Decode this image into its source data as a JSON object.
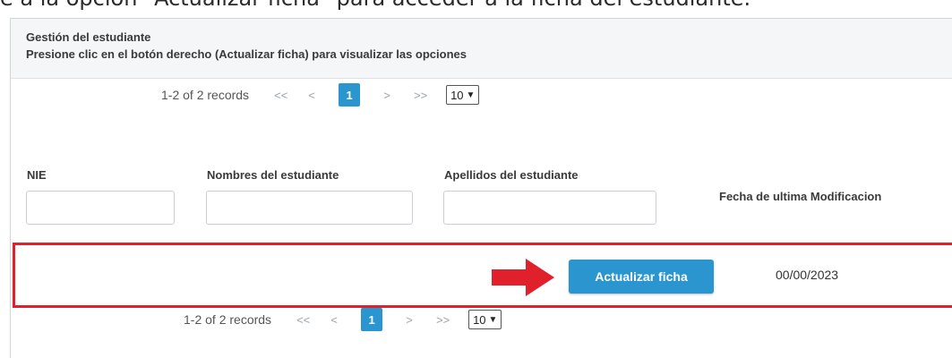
{
  "caption": "e a la opción \"Actualizar ficha\" para acceder a la ficha del estudiante.",
  "header": {
    "title": "Gestión del estudiante",
    "subtitle": "Presione clic en el botón derecho (Actualizar ficha) para visualizar las opciones"
  },
  "pagination": {
    "records": "1-2 of 2 records",
    "first": "<<",
    "prev": "<",
    "current_page": "1",
    "next": ">",
    "last": ">>",
    "page_size": "10"
  },
  "columns": {
    "nie": "NIE",
    "nombres": "Nombres del estudiante",
    "apellidos": "Apellidos del estudiante",
    "fecha": "Fecha de ultima Modificacion"
  },
  "filters": {
    "nie": "",
    "nombres": "",
    "apellidos": ""
  },
  "row": {
    "action_label": "Actualizar ficha",
    "fecha": "00/00/2023"
  },
  "colors": {
    "accent": "#2b95d0",
    "highlight": "#e0202a"
  },
  "icons": {
    "arrow": "right-arrow-icon"
  }
}
